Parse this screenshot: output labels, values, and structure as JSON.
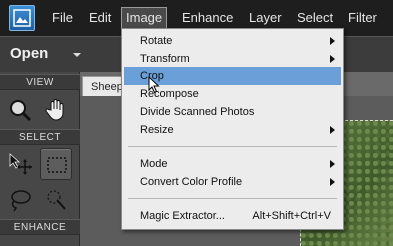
{
  "menubar": {
    "items": [
      "File",
      "Edit",
      "Image",
      "Enhance",
      "Layer",
      "Select",
      "Filter"
    ]
  },
  "toolbar": {
    "open_label": "Open"
  },
  "toolpanel": {
    "sections": [
      "VIEW",
      "SELECT",
      "ENHANCE"
    ],
    "tools": [
      "zoom-tool",
      "hand-tool",
      "move-tool",
      "marquee-tool",
      "lasso-tool",
      "quick-selection-tool"
    ]
  },
  "document": {
    "tab_label": "Sheep"
  },
  "image_menu": {
    "items": [
      {
        "label": "Rotate",
        "submenu": true
      },
      {
        "label": "Transform",
        "submenu": true
      },
      {
        "label": "Crop",
        "submenu": false,
        "highlighted": true
      },
      {
        "label": "Recompose",
        "submenu": false
      },
      {
        "label": "Divide Scanned Photos",
        "submenu": false
      },
      {
        "label": "Resize",
        "submenu": true
      },
      {
        "label": "Mode",
        "submenu": true
      },
      {
        "label": "Convert Color Profile",
        "submenu": true
      },
      {
        "label": "Magic Extractor...",
        "shortcut": "Alt+Shift+Ctrl+V",
        "submenu": false
      }
    ]
  },
  "colors": {
    "menu_highlight": "#6a9fd8",
    "menubar_bg": "#1e1e1e",
    "panel_bg": "#474747"
  }
}
